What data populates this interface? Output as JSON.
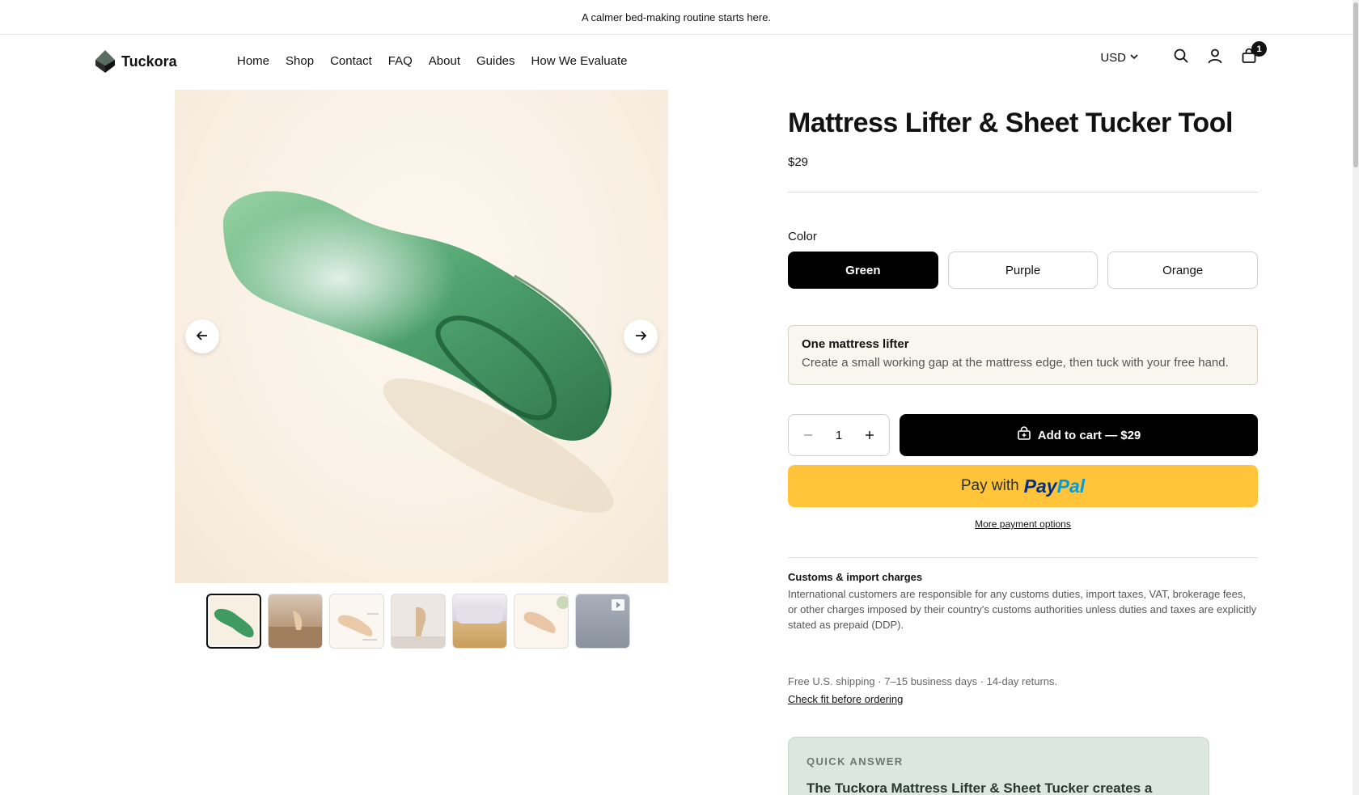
{
  "announcement": "A calmer bed-making routine starts here.",
  "header": {
    "logo_text": "Tuckora",
    "nav": [
      "Home",
      "Shop",
      "Contact",
      "FAQ",
      "About",
      "Guides",
      "How We Evaluate"
    ],
    "currency": "USD",
    "cart_count": "1"
  },
  "product": {
    "title": "Mattress Lifter & Sheet Tucker Tool",
    "price": "$29",
    "color_label": "Color",
    "colors": [
      "Green",
      "Purple",
      "Orange"
    ],
    "selected_color": "Green",
    "variant": {
      "title": "One mattress lifter",
      "description": "Create a small working gap at the mattress edge, then tuck with your free hand."
    },
    "quantity": "1",
    "add_to_cart": "Add to cart — $29",
    "paypal_prefix": "Pay with",
    "paypal_brand_1": "Pay",
    "paypal_brand_2": "Pal",
    "more_payment": "More payment options",
    "customs_title": "Customs & import charges",
    "customs_text": "International customers are responsible for any customs duties, import taxes, VAT, brokerage fees, or other charges imposed by their country's customs authorities unless duties and taxes are explicitly stated as prepaid (DDP).",
    "shipping": "Free U.S. shipping · 7–15 business days · 14-day returns.",
    "check_fit": "Check fit before ordering"
  },
  "quick_answer": {
    "label": "QUICK ANSWER",
    "heading": "The Tuckora Mattress Lifter & Sheet Tucker creates a small"
  },
  "gallery": {
    "thumbnail_count": 7,
    "active_index": 0
  },
  "colors": {
    "accent": "#000000",
    "paypal_yellow": "#ffc439",
    "product_green": "#2f8a55",
    "quick_answer_bg": "#dbe7df"
  }
}
